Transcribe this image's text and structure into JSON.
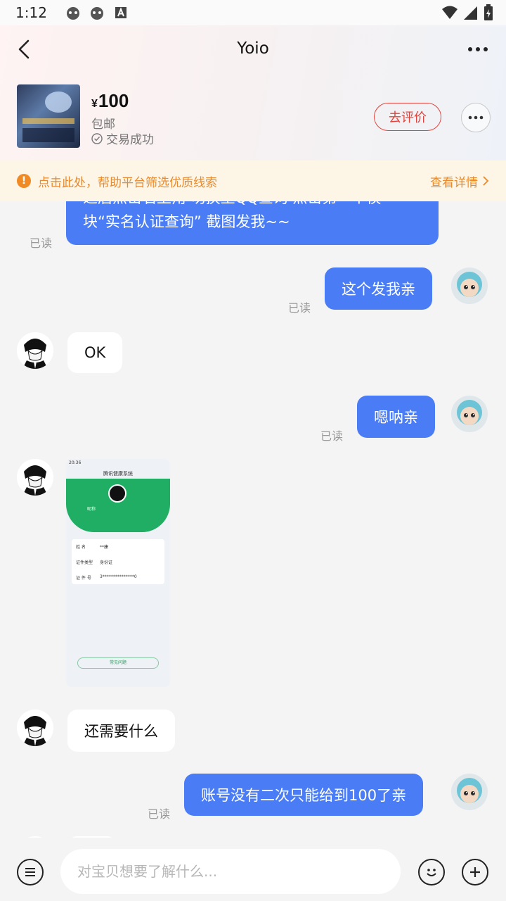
{
  "statusbar": {
    "time": "1:12"
  },
  "header": {
    "title": "Yoio",
    "price_symbol": "¥",
    "price": "100",
    "shipping": "包邮",
    "status": "交易成功",
    "rate_button": "去评价"
  },
  "notice": {
    "text": "点击此处，帮助平台筛选优质线索",
    "link": "查看详情"
  },
  "messages": {
    "m1_line1": "之后点击右上角 切换至QQ查询 点击第一个模",
    "m1_line2": "块“实名认证查询” 截图发我~~",
    "m1_read": "已读",
    "m2": "这个发我亲",
    "m2_read": "已读",
    "m3": "OK",
    "m4": "嗯呐亲",
    "m4_read": "已读",
    "m6": "还需要什么",
    "m7": "账号没有二次只能给到100了亲",
    "m7_read": "已读"
  },
  "screenshot": {
    "time": "20:36",
    "title": "腾讯健康系统",
    "nickname": "昵称",
    "name_label": "姓  名",
    "name_value": "**康",
    "id_type_label": "证件类型",
    "id_type_value": "身份证",
    "id_no_label": "证 件 号",
    "id_no_value": "3***************0",
    "help": "常见问题"
  },
  "input": {
    "placeholder": "对宝贝想要了解什么..."
  },
  "colors": {
    "accent": "#4a7cf6",
    "warning": "#e88a2d",
    "rate": "#e0443c"
  }
}
